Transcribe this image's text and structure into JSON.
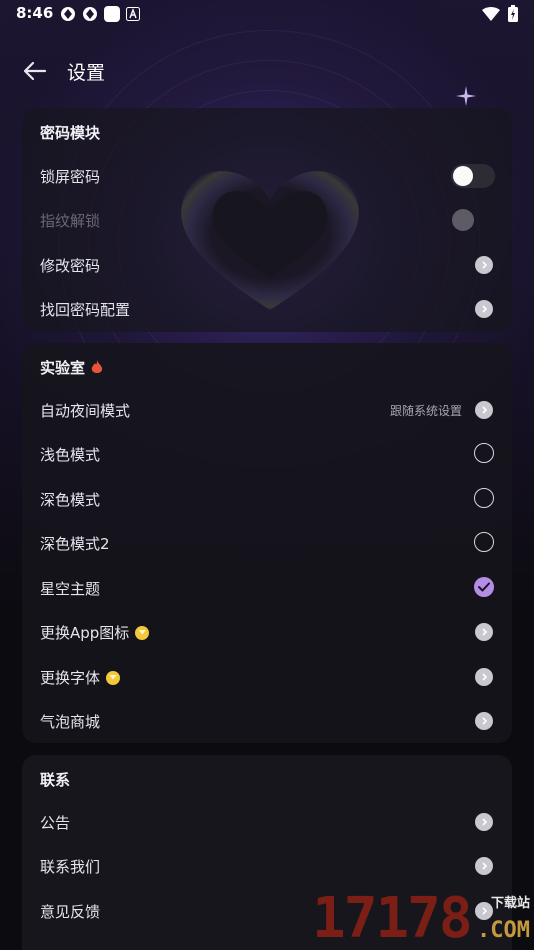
{
  "status_bar": {
    "time": "8:46"
  },
  "header": {
    "title": "设置"
  },
  "sections": {
    "password": {
      "title": "密码模块",
      "lock_screen": "锁屏密码",
      "fingerprint": "指纹解锁",
      "change_password": "修改密码",
      "recover_config": "找回密码配置"
    },
    "lab": {
      "title": "实验室",
      "auto_night": "自动夜间模式",
      "auto_night_value": "跟随系统设置",
      "light_mode": "浅色模式",
      "dark_mode": "深色模式",
      "dark_mode2": "深色模式2",
      "starry_theme": "星空主题",
      "change_icon": "更换App图标",
      "change_font": "更换字体",
      "bubble_store": "气泡商城"
    },
    "contact": {
      "title": "联系",
      "notice": "公告",
      "contact_us": "联系我们",
      "feedback": "意见反馈"
    }
  },
  "state": {
    "lock_screen_enabled": false,
    "fingerprint_disabled": true,
    "selected_theme": "星空主题"
  },
  "icons": {
    "back": "arrow-left-icon",
    "chevron": "chevron-right-icon",
    "flame": "flame-icon",
    "gem": "gem-icon"
  },
  "colors": {
    "accent": "#b48ee6",
    "flame": "#e8553a",
    "gem": "#f3c83a"
  },
  "watermark": {
    "number": "17178",
    "download": "下载站",
    "domain": ".COM"
  }
}
